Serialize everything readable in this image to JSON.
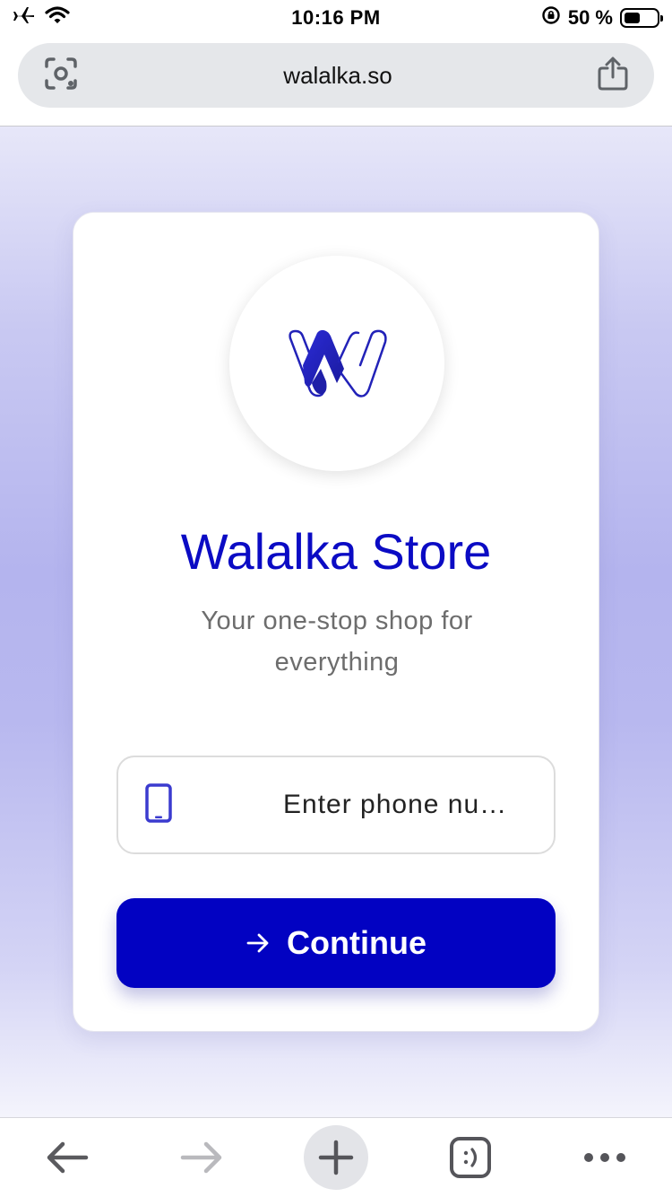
{
  "status_bar": {
    "time": "10:16 PM",
    "battery_text": "50 %",
    "battery_level": 0.5,
    "icons": [
      "airplane-icon",
      "wifi-icon",
      "orientation-lock-icon",
      "battery-icon"
    ]
  },
  "browser": {
    "url": "walalka.so",
    "left_icon": "visual-lookup-icon",
    "right_icon": "share-icon",
    "toolbar_icons": [
      "back-arrow-icon",
      "forward-arrow-icon",
      "new-tab-icon",
      "tabs-icon",
      "more-icon"
    ]
  },
  "page": {
    "logo_icon": "walalka-w-logo",
    "title": "Walalka Store",
    "subtitle": "Your one-stop shop for everything",
    "phone_placeholder": "Enter phone nu…",
    "phone_value": "",
    "continue_label": "Continue",
    "colors": {
      "brand": "#0202C2",
      "title": "#0B0BC4",
      "subtitle": "#6D6D6D",
      "phone_icon": "#3B3BCF"
    }
  }
}
